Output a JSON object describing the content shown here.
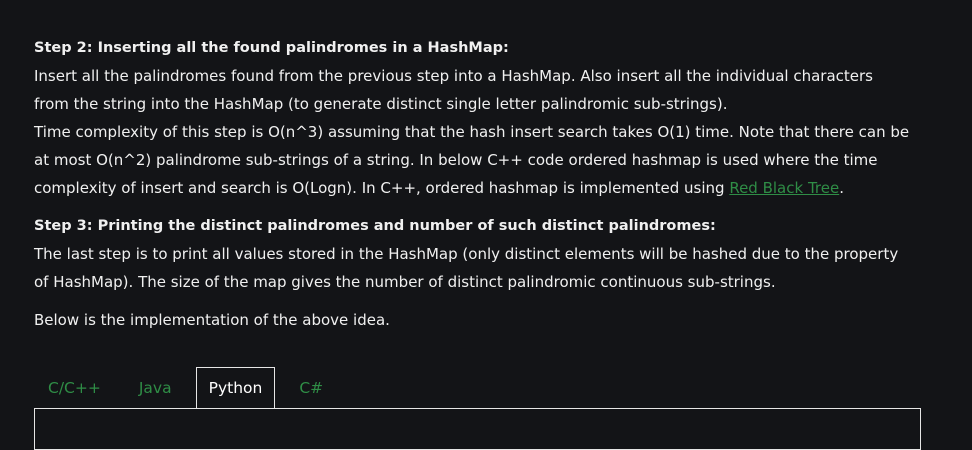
{
  "step2": {
    "heading": "Step 2: Inserting all the found palindromes in a HashMap:",
    "line1": "Insert all the palindromes found from the previous step into a HashMap. Also insert all the individual characters",
    "line2": "from the string into the HashMap (to generate distinct single letter palindromic sub-strings).",
    "line3": "Time complexity of this step is O(n^3) assuming that the hash insert search takes O(1) time. Note that there can be",
    "line4": "at most O(n^2) palindrome sub-strings of a string. In below C++ code ordered hashmap is used where the time",
    "line5_prefix": "complexity of insert and search is O(Logn). In C++, ordered hashmap is implemented using ",
    "line5_link": "Red Black Tree",
    "line5_suffix": "."
  },
  "step3": {
    "heading": "Step 3: Printing the distinct palindromes and number of such distinct palindromes:",
    "line1": "The last step is to print all values stored in the HashMap (only distinct elements will be hashed due to the property",
    "line2": "of HashMap). The size of the map gives the number of distinct palindromic continuous sub-strings."
  },
  "implementation_note": "Below is the implementation of the above idea.",
  "tabs": [
    {
      "label": "C/C++",
      "active": false
    },
    {
      "label": "Java",
      "active": false
    },
    {
      "label": "Python",
      "active": true
    },
    {
      "label": "C#",
      "active": false
    }
  ],
  "colors": {
    "background": "#131417",
    "text": "#f0f0f0",
    "link": "#2f8d46",
    "tab_inactive": "#2f8d46"
  }
}
